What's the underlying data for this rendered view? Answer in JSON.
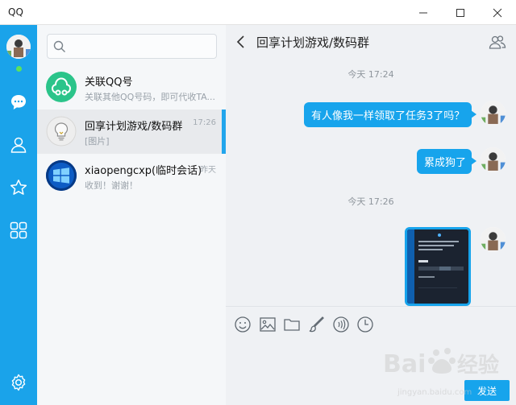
{
  "window": {
    "title": "QQ",
    "controls": {
      "minimize": "minimize",
      "maximize": "maximize",
      "close": "close"
    }
  },
  "sidebar": {
    "icons": [
      "chat-icon",
      "contacts-icon",
      "favorites-icon",
      "apps-icon",
      "settings-icon"
    ],
    "accent": "#1aa3ea",
    "status": "online"
  },
  "search": {
    "value": "",
    "placeholder": ""
  },
  "conversations": [
    {
      "name": "关联QQ号",
      "preview": "关联其他QQ号码，即可代收TA...",
      "time": "",
      "avatar_color": "#2bc48a"
    },
    {
      "name": "回享计划游戏/数码群",
      "preview": "[图片]",
      "time": "17:26",
      "selected": true
    },
    {
      "name": "xiaopengcxp(临时会话)",
      "preview": "收到！谢谢！",
      "time": "昨天"
    }
  ],
  "chat": {
    "title": "回享计划游戏/数码群",
    "messages": [
      {
        "type": "timestamp",
        "text": "今天 17:24"
      },
      {
        "type": "text",
        "text": "有人像我一样领取了任务3了吗？"
      },
      {
        "type": "text",
        "text": "累成狗了"
      },
      {
        "type": "timestamp",
        "text": "今天 17:26"
      },
      {
        "type": "image",
        "text": ""
      }
    ],
    "toolbar": [
      "emoji-icon",
      "image-icon",
      "folder-icon",
      "brush-icon",
      "voice-icon",
      "history-icon"
    ],
    "send_label": "发送",
    "bubble_color": "#17a4ec"
  },
  "watermark": {
    "text": "jingyan.baidu.com"
  }
}
